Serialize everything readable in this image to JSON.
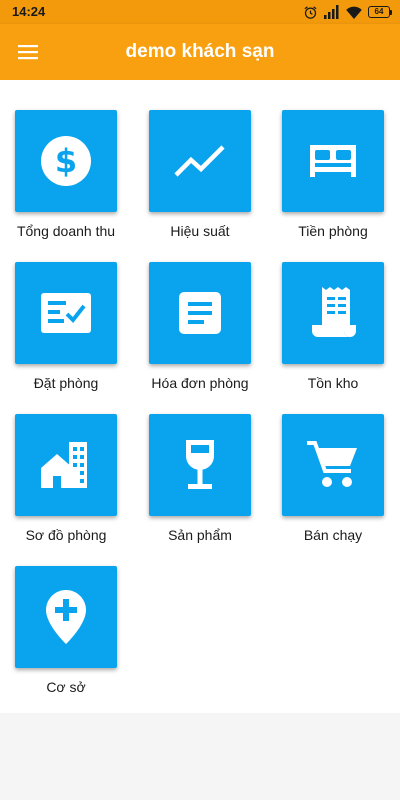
{
  "status_bar": {
    "time": "14:24",
    "battery_level": "64",
    "icons": [
      "alarm-icon",
      "signal-icon",
      "wifi-icon",
      "battery-icon"
    ]
  },
  "app_bar": {
    "title": "demo khách sạn",
    "menu_icon": "menu-icon",
    "color": "#f8a00f"
  },
  "menu": {
    "tile_color": "#0aa4ee",
    "items": [
      {
        "label": "Tổng doanh thu",
        "icon": "dollar-icon"
      },
      {
        "label": "Hiệu suất",
        "icon": "trending-up-icon"
      },
      {
        "label": "Tiền phòng",
        "icon": "bed-icon"
      },
      {
        "label": "Đặt phòng",
        "icon": "checklist-icon"
      },
      {
        "label": "Hóa đơn phòng",
        "icon": "document-icon"
      },
      {
        "label": "Tồn kho",
        "icon": "receipt-icon"
      },
      {
        "label": "Sơ đồ phòng",
        "icon": "building-icon"
      },
      {
        "label": "Sản phẩm",
        "icon": "wine-glass-icon"
      },
      {
        "label": "Bán chạy",
        "icon": "cart-icon"
      },
      {
        "label": "Cơ sở",
        "icon": "location-add-icon"
      }
    ]
  }
}
